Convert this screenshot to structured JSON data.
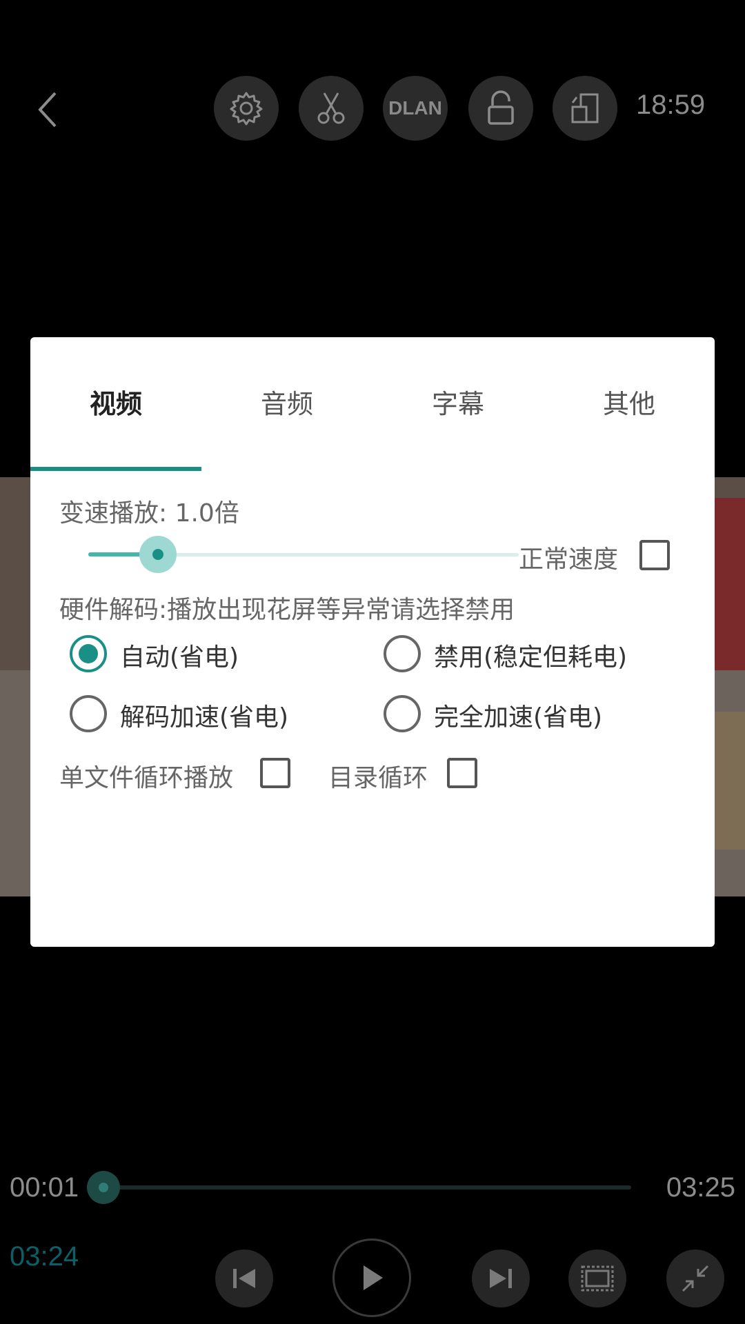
{
  "top_bar": {
    "clock": "18:59",
    "dlan_label": "DLAN"
  },
  "player": {
    "elapsed": "00:01",
    "duration": "03:25",
    "remaining": "03:24",
    "progress_fraction": 0.005
  },
  "dialog": {
    "tabs": [
      {
        "label": "视频",
        "active": true
      },
      {
        "label": "音频",
        "active": false
      },
      {
        "label": "字幕",
        "active": false
      },
      {
        "label": "其他",
        "active": false
      }
    ],
    "speed": {
      "label": "变速播放:  1.0倍",
      "slider_fraction": 0.13,
      "normal_speed_label": "正常速度",
      "normal_speed_checked": false
    },
    "hw_decode": {
      "label": "硬件解码:播放出现花屏等异常请选择禁用",
      "options": [
        {
          "label": "自动(省电)",
          "checked": true
        },
        {
          "label": "禁用(稳定但耗电)",
          "checked": false
        },
        {
          "label": "解码加速(省电)",
          "checked": false
        },
        {
          "label": "完全加速(省电)",
          "checked": false
        }
      ]
    },
    "loop": {
      "single_file_label": "单文件循环播放",
      "single_file_checked": false,
      "directory_label": "目录循环",
      "directory_checked": false
    }
  },
  "colors": {
    "accent": "#1a8f86",
    "slider_light": "#9dd8d3",
    "remaining_time": "#0c5f66"
  }
}
